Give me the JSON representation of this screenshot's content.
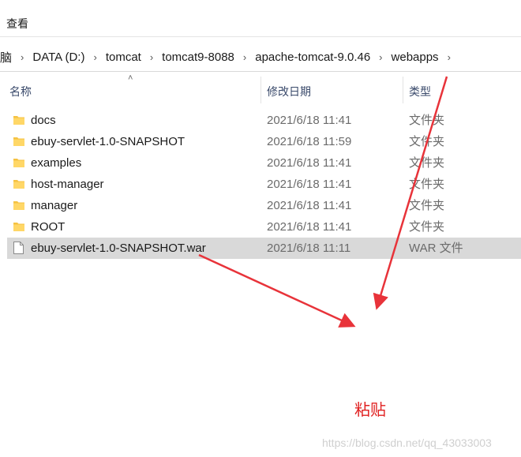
{
  "ribbon": {
    "tab_label": "查看"
  },
  "breadcrumb": [
    "脑",
    "DATA (D:)",
    "tomcat",
    "tomcat9-8088",
    "apache-tomcat-9.0.46",
    "webapps"
  ],
  "columns": {
    "name": "名称",
    "date": "修改日期",
    "type": "类型"
  },
  "files": [
    {
      "name": "docs",
      "date": "2021/6/18 11:41",
      "type": "文件夹",
      "kind": "folder-icon",
      "selected": false
    },
    {
      "name": "ebuy-servlet-1.0-SNAPSHOT",
      "date": "2021/6/18 11:59",
      "type": "文件夹",
      "kind": "folder-icon",
      "selected": false
    },
    {
      "name": "examples",
      "date": "2021/6/18 11:41",
      "type": "文件夹",
      "kind": "folder-icon",
      "selected": false
    },
    {
      "name": "host-manager",
      "date": "2021/6/18 11:41",
      "type": "文件夹",
      "kind": "folder-icon",
      "selected": false
    },
    {
      "name": "manager",
      "date": "2021/6/18 11:41",
      "type": "文件夹",
      "kind": "folder-icon",
      "selected": false
    },
    {
      "name": "ROOT",
      "date": "2021/6/18 11:41",
      "type": "文件夹",
      "kind": "folder-icon",
      "selected": false
    },
    {
      "name": "ebuy-servlet-1.0-SNAPSHOT.war",
      "date": "2021/6/18 11:11",
      "type": "WAR 文件",
      "kind": "file-icon",
      "selected": true
    }
  ],
  "annotation": {
    "label": "粘贴",
    "color": "#e02020"
  },
  "watermark": "https://blog.csdn.net/qq_43033003",
  "colors": {
    "folder": "#f5c242",
    "arrow": "#e8333a",
    "selected_row": "#d9d9d9"
  }
}
